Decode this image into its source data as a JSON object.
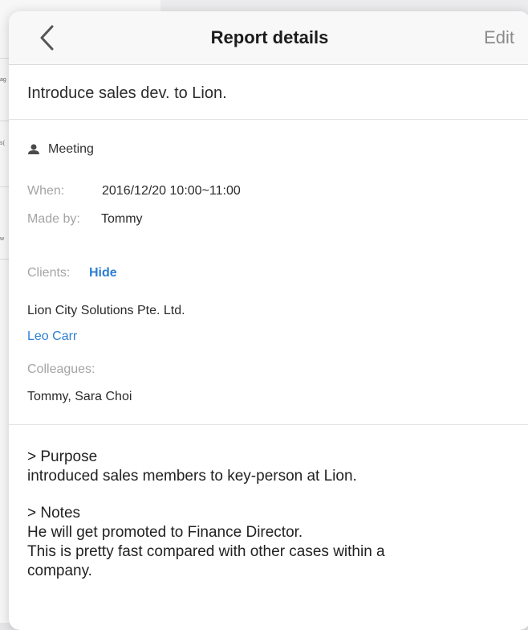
{
  "background": {
    "fragments": [
      "ag",
      "s(",
      "w"
    ]
  },
  "navbar": {
    "back_icon": "chevron-left-icon",
    "title": "Report details",
    "edit_label": "Edit"
  },
  "report": {
    "subject": "Introduce sales dev. to Lion.",
    "type_icon": "person-icon",
    "type": "Meeting",
    "when_label": "When:",
    "when_value": "2016/12/20 10:00~11:00",
    "made_by_label": "Made by:",
    "made_by_value": "Tommy",
    "clients_label": "Clients:",
    "clients_toggle": "Hide",
    "company": "Lion City Solutions Pte. Ltd.",
    "contact": "Leo Carr",
    "colleagues_label": "Colleagues:",
    "colleagues_value": "Tommy, Sara Choi"
  },
  "notes": {
    "purpose_heading": "> Purpose",
    "purpose_text": "introduced sales members to key-person at Lion.",
    "notes_heading": "> Notes",
    "notes_lines": [
      "He will get promoted to Finance Director.",
      "This is pretty fast compared with other cases within a",
      "company."
    ]
  },
  "colors": {
    "link": "#2b7fd4",
    "label_gray": "#a4a4a4",
    "nav_background": "#f8f8f8"
  }
}
